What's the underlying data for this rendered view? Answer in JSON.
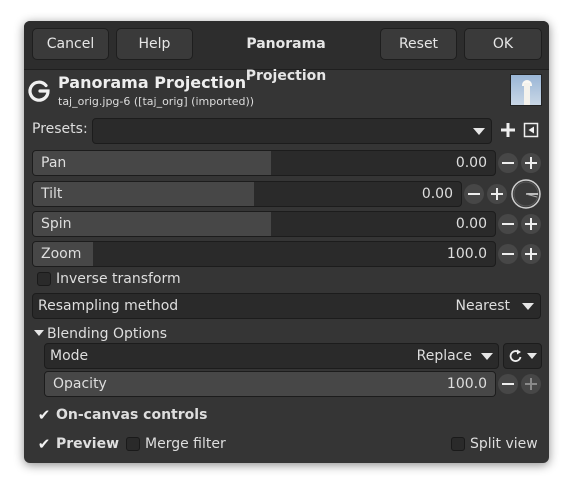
{
  "header": {
    "cancel": "Cancel",
    "help": "Help",
    "title": "Panorama Projection",
    "reset": "Reset",
    "ok": "OK"
  },
  "operation": {
    "title": "Panorama Projection",
    "subtitle": "taj_orig.jpg-6 ([taj_orig] (imported))"
  },
  "presets": {
    "label": "Presets:",
    "value": ""
  },
  "params": [
    {
      "label": "Pan",
      "value": "0.00",
      "fill": 0.51
    },
    {
      "label": "Tilt",
      "value": "0.00",
      "fill": 0.51
    },
    {
      "label": "Spin",
      "value": "0.00",
      "fill": 0.51
    },
    {
      "label": "Zoom",
      "value": "100.0",
      "fill": 0.12
    }
  ],
  "inverse": {
    "label": "Inverse transform",
    "checked": false
  },
  "resampling": {
    "label": "Resampling method",
    "value": "Nearest"
  },
  "blending": {
    "title": "Blending Options",
    "mode_label": "Mode",
    "mode_value": "Replace",
    "opacity_label": "Opacity",
    "opacity_value": "100.0",
    "opacity_fill": 1.0
  },
  "on_canvas": {
    "label": "On-canvas controls",
    "checked": true
  },
  "preview": {
    "label": "Preview",
    "checked": true
  },
  "merge": {
    "label": "Merge filter",
    "checked": false
  },
  "split": {
    "label": "Split view",
    "checked": false
  }
}
